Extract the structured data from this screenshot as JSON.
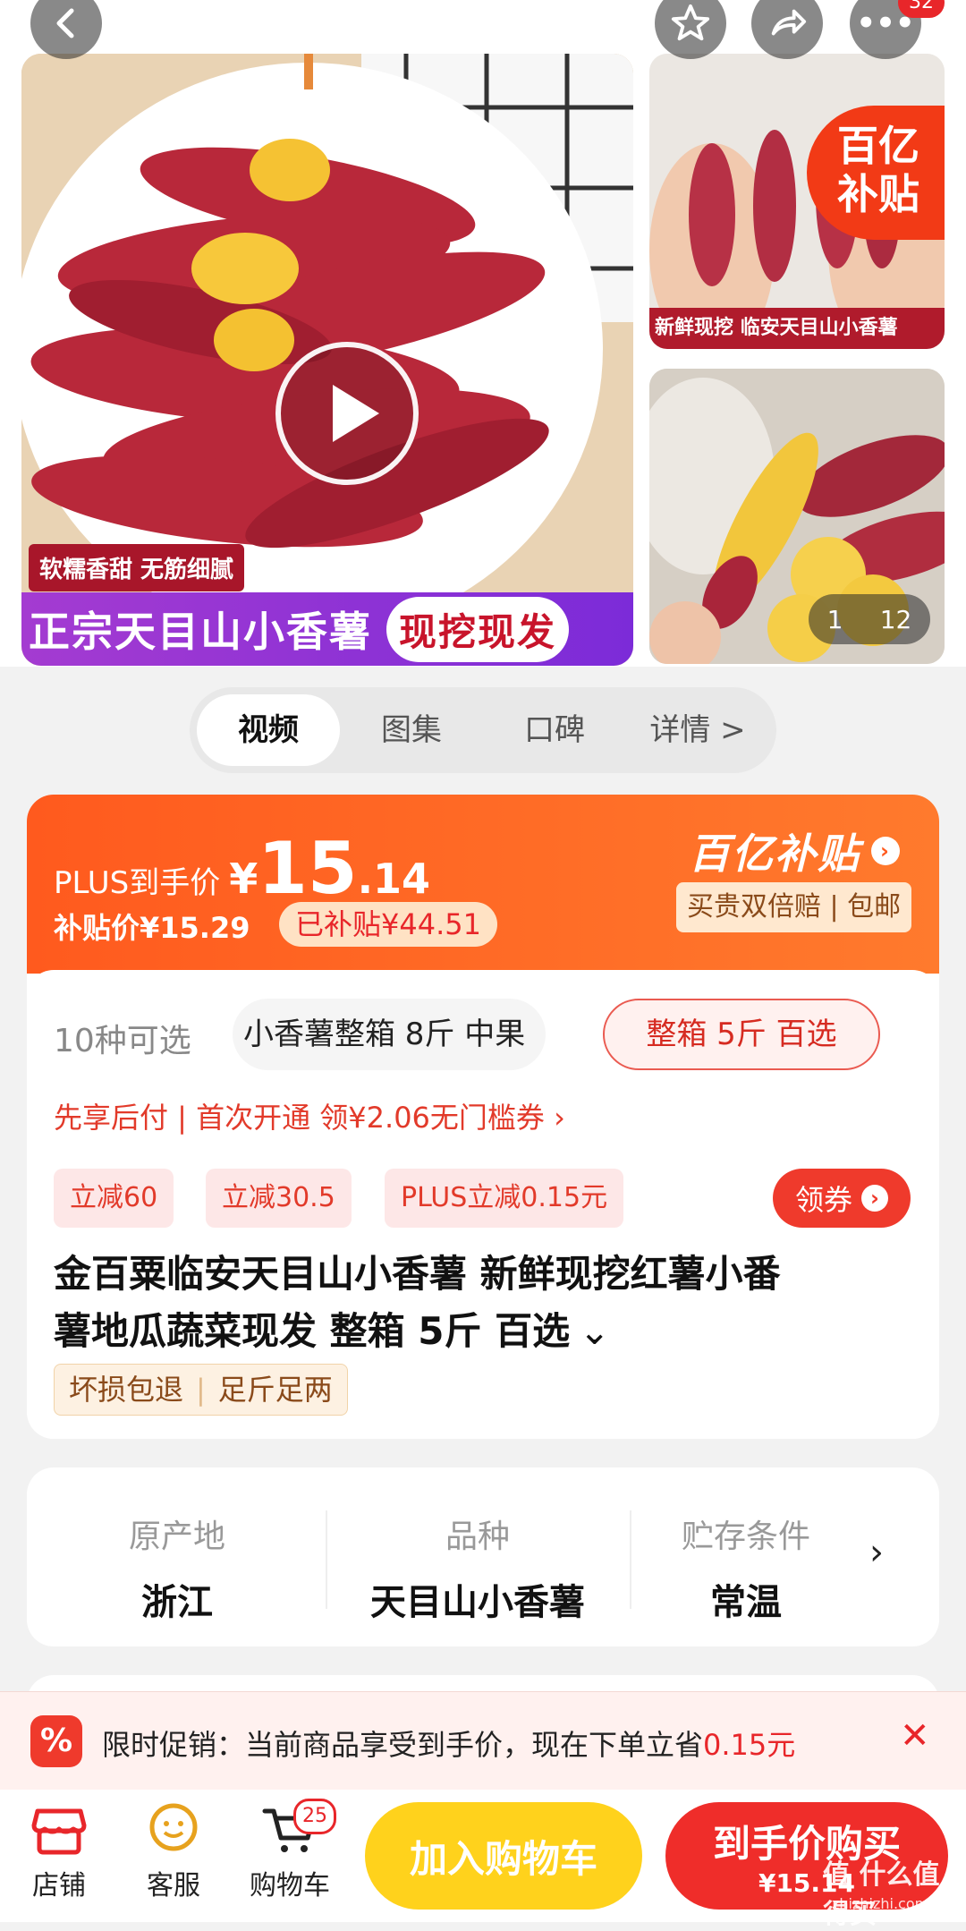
{
  "header": {
    "back_icon": "chevron-left-icon",
    "favorite_icon": "star-icon",
    "share_icon": "share-icon",
    "more_icon": "more-icon",
    "more_badge": "32"
  },
  "gallery": {
    "tag_left": "软糯香甜 无筋细腻",
    "banner_main": "正宗天目山小香薯",
    "banner_badge": "现挖现发",
    "thumb1_badge_line1": "百亿",
    "thumb1_badge_line2": "补贴",
    "thumb1_caption": "新鲜现挖 临安天目山小香薯",
    "counter_current": "1",
    "counter_total": "12"
  },
  "tabs": [
    "视频",
    "图集",
    "口碑",
    "详情 >"
  ],
  "price": {
    "plus_label": "PLUS到手价",
    "currency": "¥",
    "price_int": "15",
    "price_dec": ".14",
    "subsidy_price": "补贴价¥15.29",
    "subsidized": "已补贴¥44.51",
    "brand_logo": "百亿补贴",
    "guarantee": "买贵双倍赔 | 包邮"
  },
  "options": {
    "count": "10种可选",
    "opt1": "小香薯整箱 8斤 中果",
    "opt2": "整箱 5斤 百选"
  },
  "payline": "先享后付 | 首次开通 领¥2.06无门槛券 ›",
  "coupons": [
    "立减60",
    "立减30.5",
    "PLUS立减0.15元"
  ],
  "coupon_button": "领券",
  "product_title_line1": "金百粟临安天目山小香薯 新鲜现挖红薯小番",
  "product_title_line2": "薯地瓜蔬菜现发 整箱 5斤 百选",
  "service_tags": [
    "坏损包退",
    "足斤足两"
  ],
  "specs": [
    {
      "k": "原产地",
      "v": "浙江"
    },
    {
      "k": "品种",
      "v": "天目山小香薯"
    },
    {
      "k": "贮存条件",
      "v": "常温"
    }
  ],
  "promo": {
    "label": "限时促销：当前商品享受到手价，现在下单立省",
    "amount": "0.15元"
  },
  "bottom": {
    "store": "店铺",
    "service": "客服",
    "cart": "购物车",
    "cart_badge": "25",
    "add_cart": "加入购物车",
    "buy": "到手价购买",
    "buy_price": "¥15.14"
  },
  "watermark": "值 什么值得买",
  "watermark_url": "zhizhizhi.com",
  "colors": {
    "accent": "#ff4a1a",
    "red": "#e8262a",
    "yellow": "#ffd21c"
  }
}
